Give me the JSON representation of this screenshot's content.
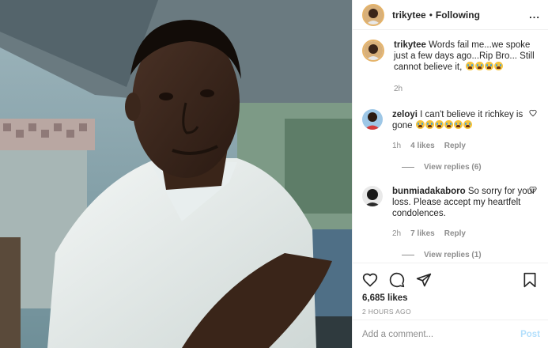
{
  "post": {
    "username": "trikytee",
    "separator": "•",
    "follow_status": "Following",
    "more_label": "...",
    "caption_user": "trikytee",
    "caption_text": "Words fail me...we spoke just a few days ago...Rip Bro... Still cannot believe it",
    "caption_emoji_count": 4,
    "caption_time": "2h"
  },
  "comments": [
    {
      "user": "zeloyi",
      "text": "I can't believe it richkey is gone",
      "emoji_count": 6,
      "time": "1h",
      "likes": "4 likes",
      "reply": "Reply",
      "view_replies": "View replies (6)"
    },
    {
      "user": "bunmiadakaboro",
      "text": "So sorry for your loss. Please accept my heartfelt condolences.",
      "emoji_count": 0,
      "time": "2h",
      "likes": "7 likes",
      "reply": "Reply",
      "view_replies": "View replies (1)"
    }
  ],
  "engagement": {
    "likes": "6,685 likes",
    "timestamp": "2 HOURS AGO"
  },
  "add_comment": {
    "placeholder": "Add a comment...",
    "post_label": "Post"
  },
  "icons": [
    "heart-icon",
    "comment-icon",
    "share-icon",
    "bookmark-icon"
  ],
  "colors": {
    "post_button": "#b2dffc",
    "muted": "#8e8e8e",
    "text": "#262626"
  }
}
